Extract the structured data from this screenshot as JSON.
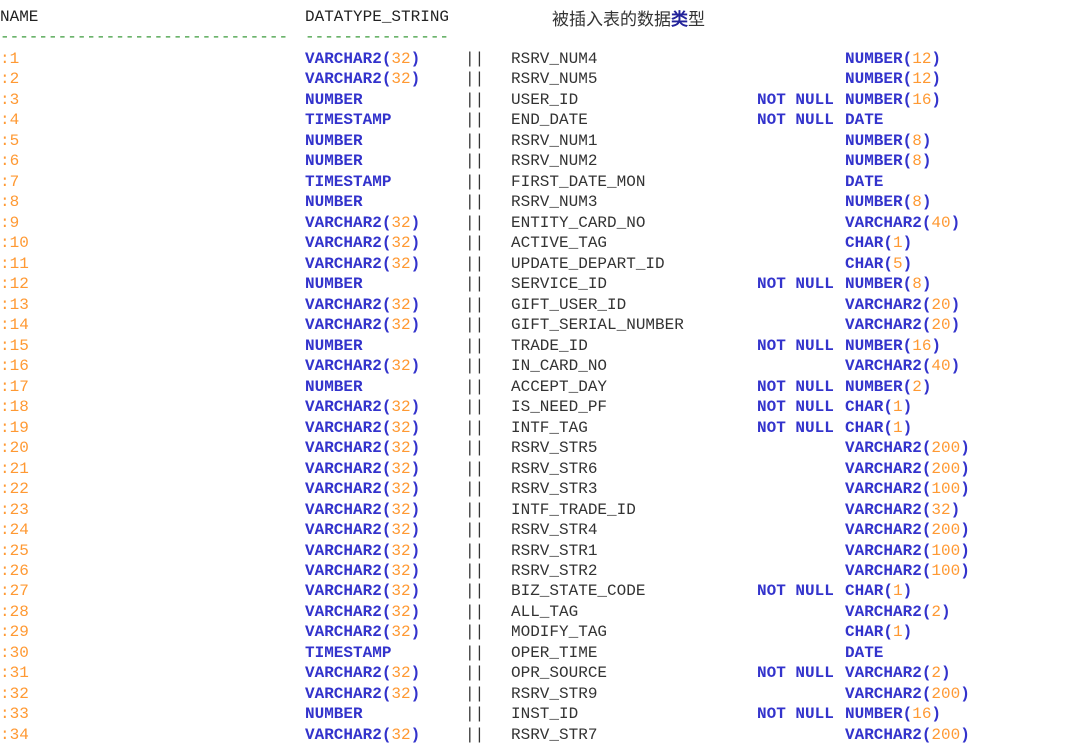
{
  "header": {
    "name": "NAME",
    "datatype": "DATATYPE_STRING",
    "title_pre": "被插入表的数据",
    "title_hl": "类",
    "title_post": "型",
    "dash1": "------------------------------",
    "dash2": "---------------",
    "sep": "||",
    "not_null": "NOT NULL"
  },
  "colors": {
    "keyword": "#3333cc",
    "number": "#ff9933",
    "dash": "#3a9a3a"
  },
  "rows": [
    {
      "n": "1",
      "dt": "VARCHAR2",
      "dl": "32",
      "col": "RSRV_NUM4",
      "nn": false,
      "t": "NUMBER",
      "tl": "12"
    },
    {
      "n": "2",
      "dt": "VARCHAR2",
      "dl": "32",
      "col": "RSRV_NUM5",
      "nn": false,
      "t": "NUMBER",
      "tl": "12"
    },
    {
      "n": "3",
      "dt": "NUMBER",
      "dl": "",
      "col": "USER_ID",
      "nn": true,
      "t": "NUMBER",
      "tl": "16"
    },
    {
      "n": "4",
      "dt": "TIMESTAMP",
      "dl": "",
      "col": "END_DATE",
      "nn": true,
      "t": "DATE",
      "tl": ""
    },
    {
      "n": "5",
      "dt": "NUMBER",
      "dl": "",
      "col": "RSRV_NUM1",
      "nn": false,
      "t": "NUMBER",
      "tl": "8"
    },
    {
      "n": "6",
      "dt": "NUMBER",
      "dl": "",
      "col": "RSRV_NUM2",
      "nn": false,
      "t": "NUMBER",
      "tl": "8"
    },
    {
      "n": "7",
      "dt": "TIMESTAMP",
      "dl": "",
      "col": "FIRST_DATE_MON",
      "nn": false,
      "t": "DATE",
      "tl": ""
    },
    {
      "n": "8",
      "dt": "NUMBER",
      "dl": "",
      "col": "RSRV_NUM3",
      "nn": false,
      "t": "NUMBER",
      "tl": "8"
    },
    {
      "n": "9",
      "dt": "VARCHAR2",
      "dl": "32",
      "col": "ENTITY_CARD_NO",
      "nn": false,
      "t": "VARCHAR2",
      "tl": "40"
    },
    {
      "n": "10",
      "dt": "VARCHAR2",
      "dl": "32",
      "col": "ACTIVE_TAG",
      "nn": false,
      "t": "CHAR",
      "tl": "1"
    },
    {
      "n": "11",
      "dt": "VARCHAR2",
      "dl": "32",
      "col": "UPDATE_DEPART_ID",
      "nn": false,
      "t": "CHAR",
      "tl": "5"
    },
    {
      "n": "12",
      "dt": "NUMBER",
      "dl": "",
      "col": "SERVICE_ID",
      "nn": true,
      "t": "NUMBER",
      "tl": "8"
    },
    {
      "n": "13",
      "dt": "VARCHAR2",
      "dl": "32",
      "col": "GIFT_USER_ID",
      "nn": false,
      "t": "VARCHAR2",
      "tl": "20"
    },
    {
      "n": "14",
      "dt": "VARCHAR2",
      "dl": "32",
      "col": "GIFT_SERIAL_NUMBER",
      "nn": false,
      "t": "VARCHAR2",
      "tl": "20"
    },
    {
      "n": "15",
      "dt": "NUMBER",
      "dl": "",
      "col": "TRADE_ID",
      "nn": true,
      "t": "NUMBER",
      "tl": "16"
    },
    {
      "n": "16",
      "dt": "VARCHAR2",
      "dl": "32",
      "col": "IN_CARD_NO",
      "nn": false,
      "t": "VARCHAR2",
      "tl": "40"
    },
    {
      "n": "17",
      "dt": "NUMBER",
      "dl": "",
      "col": "ACCEPT_DAY",
      "nn": true,
      "t": "NUMBER",
      "tl": "2"
    },
    {
      "n": "18",
      "dt": "VARCHAR2",
      "dl": "32",
      "col": "IS_NEED_PF",
      "nn": true,
      "t": "CHAR",
      "tl": "1"
    },
    {
      "n": "19",
      "dt": "VARCHAR2",
      "dl": "32",
      "col": "INTF_TAG",
      "nn": true,
      "t": "CHAR",
      "tl": "1"
    },
    {
      "n": "20",
      "dt": "VARCHAR2",
      "dl": "32",
      "col": "RSRV_STR5",
      "nn": false,
      "t": "VARCHAR2",
      "tl": "200"
    },
    {
      "n": "21",
      "dt": "VARCHAR2",
      "dl": "32",
      "col": "RSRV_STR6",
      "nn": false,
      "t": "VARCHAR2",
      "tl": "200"
    },
    {
      "n": "22",
      "dt": "VARCHAR2",
      "dl": "32",
      "col": "RSRV_STR3",
      "nn": false,
      "t": "VARCHAR2",
      "tl": "100"
    },
    {
      "n": "23",
      "dt": "VARCHAR2",
      "dl": "32",
      "col": "INTF_TRADE_ID",
      "nn": false,
      "t": "VARCHAR2",
      "tl": "32"
    },
    {
      "n": "24",
      "dt": "VARCHAR2",
      "dl": "32",
      "col": "RSRV_STR4",
      "nn": false,
      "t": "VARCHAR2",
      "tl": "200"
    },
    {
      "n": "25",
      "dt": "VARCHAR2",
      "dl": "32",
      "col": "RSRV_STR1",
      "nn": false,
      "t": "VARCHAR2",
      "tl": "100"
    },
    {
      "n": "26",
      "dt": "VARCHAR2",
      "dl": "32",
      "col": "RSRV_STR2",
      "nn": false,
      "t": "VARCHAR2",
      "tl": "100"
    },
    {
      "n": "27",
      "dt": "VARCHAR2",
      "dl": "32",
      "col": "BIZ_STATE_CODE",
      "nn": true,
      "t": "CHAR",
      "tl": "1"
    },
    {
      "n": "28",
      "dt": "VARCHAR2",
      "dl": "32",
      "col": "ALL_TAG",
      "nn": false,
      "t": "VARCHAR2",
      "tl": "2"
    },
    {
      "n": "29",
      "dt": "VARCHAR2",
      "dl": "32",
      "col": "MODIFY_TAG",
      "nn": false,
      "t": "CHAR",
      "tl": "1"
    },
    {
      "n": "30",
      "dt": "TIMESTAMP",
      "dl": "",
      "col": "OPER_TIME",
      "nn": false,
      "t": "DATE",
      "tl": ""
    },
    {
      "n": "31",
      "dt": "VARCHAR2",
      "dl": "32",
      "col": "OPR_SOURCE",
      "nn": true,
      "t": "VARCHAR2",
      "tl": "2"
    },
    {
      "n": "32",
      "dt": "VARCHAR2",
      "dl": "32",
      "col": "RSRV_STR9",
      "nn": false,
      "t": "VARCHAR2",
      "tl": "200"
    },
    {
      "n": "33",
      "dt": "NUMBER",
      "dl": "",
      "col": "INST_ID",
      "nn": true,
      "t": "NUMBER",
      "tl": "16"
    },
    {
      "n": "34",
      "dt": "VARCHAR2",
      "dl": "32",
      "col": "RSRV_STR7",
      "nn": false,
      "t": "VARCHAR2",
      "tl": "200"
    }
  ]
}
